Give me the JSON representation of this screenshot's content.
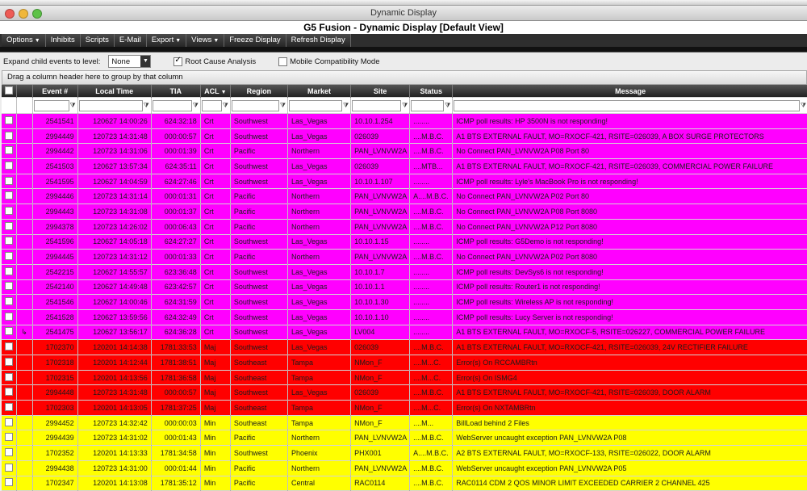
{
  "window": {
    "title": "Dynamic Display",
    "app_title": "G5 Fusion - Dynamic Display [Default View]"
  },
  "colors": {
    "crit": "#ff00ff",
    "maj": "#ff0000",
    "min": "#ffff00"
  },
  "menubar": [
    {
      "label": "Options",
      "caret": true
    },
    {
      "label": "Inhibits",
      "caret": false
    },
    {
      "label": "Scripts",
      "caret": false
    },
    {
      "label": "E-Mail",
      "caret": false
    },
    {
      "label": "Export",
      "caret": true
    },
    {
      "label": "Views",
      "caret": true
    },
    {
      "label": "Freeze Display",
      "caret": false
    },
    {
      "label": "Refresh Display",
      "caret": false
    }
  ],
  "options": {
    "expand_label": "Expand child events to level:",
    "expand_value": "None",
    "root_cause_label": "Root Cause Analysis",
    "root_cause_checked": true,
    "mobile_label": "Mobile Compatibility Mode",
    "mobile_checked": false
  },
  "group_hint": "Drag a column header here to group by that column",
  "columns": [
    "Event #",
    "Local Time",
    "TIA",
    "ACL",
    "Region",
    "Market",
    "Site",
    "Status",
    "Message"
  ],
  "rows": [
    {
      "sev": "crit",
      "event": "2541541",
      "time": "120627 14:00:26",
      "tia": "624:32:18",
      "acl": "Crt",
      "region": "Southwest",
      "market": "Las_Vegas",
      "site": "10.10.1.254",
      "status": "........",
      "msg": "ICMP poll results: HP 3500N is not responding!"
    },
    {
      "sev": "crit",
      "event": "2994449",
      "time": "120723 14:31:48",
      "tia": "000:00:57",
      "acl": "Crt",
      "region": "Southwest",
      "market": "Las_Vegas",
      "site": "026039",
      "status": "....M.B.C.",
      "msg": "A1 BTS EXTERNAL FAULT, MO=RXOCF-421, RSITE=026039, A BOX SURGE PROTECTORS"
    },
    {
      "sev": "crit",
      "event": "2994442",
      "time": "120723 14:31:06",
      "tia": "000:01:39",
      "acl": "Crt",
      "region": "Pacific",
      "market": "Northern",
      "site": "PAN_LVNVW2A",
      "status": "....M.B.C.",
      "msg": "No Connect PAN_LVNVW2A P08 Port 80"
    },
    {
      "sev": "crit",
      "event": "2541503",
      "time": "120627 13:57:34",
      "tia": "624:35:11",
      "acl": "Crt",
      "region": "Southwest",
      "market": "Las_Vegas",
      "site": "026039",
      "status": "....MTB...",
      "msg": "A1 BTS EXTERNAL FAULT, MO=RXOCF-421, RSITE=026039, COMMERCIAL POWER FAILURE"
    },
    {
      "sev": "crit",
      "event": "2541595",
      "time": "120627 14:04:59",
      "tia": "624:27:46",
      "acl": "Crt",
      "region": "Southwest",
      "market": "Las_Vegas",
      "site": "10.10.1.107",
      "status": "........",
      "msg": "ICMP poll results: Lyle's MacBook Pro is not responding!"
    },
    {
      "sev": "crit",
      "event": "2994446",
      "time": "120723 14:31:14",
      "tia": "000:01:31",
      "acl": "Crt",
      "region": "Pacific",
      "market": "Northern",
      "site": "PAN_LVNVW2A",
      "status": "A....M.B.C.",
      "msg": "No Connect PAN_LVNVW2A P02 Port 80"
    },
    {
      "sev": "crit",
      "event": "2994443",
      "time": "120723 14:31:08",
      "tia": "000:01:37",
      "acl": "Crt",
      "region": "Pacific",
      "market": "Northern",
      "site": "PAN_LVNVW2A",
      "status": "....M.B.C.",
      "msg": "No Connect PAN_LVNVW2A P08 Port 8080"
    },
    {
      "sev": "crit",
      "event": "2994378",
      "time": "120723 14:26:02",
      "tia": "000:06:43",
      "acl": "Crt",
      "region": "Pacific",
      "market": "Northern",
      "site": "PAN_LVNVW2A",
      "status": "....M.B.C.",
      "msg": "No Connect PAN_LVNVW2A P12 Port 8080"
    },
    {
      "sev": "crit",
      "event": "2541596",
      "time": "120627 14:05:18",
      "tia": "624:27:27",
      "acl": "Crt",
      "region": "Southwest",
      "market": "Las_Vegas",
      "site": "10.10.1.15",
      "status": "........",
      "msg": "ICMP poll results: G5Demo is not responding!"
    },
    {
      "sev": "crit",
      "event": "2994445",
      "time": "120723 14:31:12",
      "tia": "000:01:33",
      "acl": "Crt",
      "region": "Pacific",
      "market": "Northern",
      "site": "PAN_LVNVW2A",
      "status": "....M.B.C.",
      "msg": "No Connect PAN_LVNVW2A P02 Port 8080"
    },
    {
      "sev": "crit",
      "event": "2542215",
      "time": "120627 14:55:57",
      "tia": "623:36:48",
      "acl": "Crt",
      "region": "Southwest",
      "market": "Las_Vegas",
      "site": "10.10.1.7",
      "status": "........",
      "msg": "ICMP poll results: DevSys6 is not responding!"
    },
    {
      "sev": "crit",
      "event": "2542140",
      "time": "120627 14:49:48",
      "tia": "623:42:57",
      "acl": "Crt",
      "region": "Southwest",
      "market": "Las_Vegas",
      "site": "10.10.1.1",
      "status": "........",
      "msg": "ICMP poll results: Router1 is not responding!"
    },
    {
      "sev": "crit",
      "event": "2541546",
      "time": "120627 14:00:46",
      "tia": "624:31:59",
      "acl": "Crt",
      "region": "Southwest",
      "market": "Las_Vegas",
      "site": "10.10.1.30",
      "status": "........",
      "msg": "ICMP poll results: Wireless AP is not responding!"
    },
    {
      "sev": "crit",
      "event": "2541528",
      "time": "120627 13:59:56",
      "tia": "624:32:49",
      "acl": "Crt",
      "region": "Southwest",
      "market": "Las_Vegas",
      "site": "10.10.1.10",
      "status": "........",
      "msg": "ICMP poll results: Lucy Server is not responding!"
    },
    {
      "sev": "crit",
      "event": "2541475",
      "time": "120627 13:56:17",
      "tia": "624:36:28",
      "acl": "Crt",
      "region": "Southwest",
      "market": "Las_Vegas",
      "site": "LV004",
      "status": "........",
      "msg": "A1 BTS EXTERNAL FAULT, MO=RXOCF-5, RSITE=026227, COMMERCIAL POWER FAILURE",
      "child": true
    },
    {
      "sev": "maj",
      "event": "1702370",
      "time": "120201 14:14:38",
      "tia": "1781:33:53",
      "acl": "Maj",
      "region": "Southwest",
      "market": "Las_Vegas",
      "site": "026039",
      "status": "....M.B.C.",
      "msg": "A1 BTS EXTERNAL FAULT, MO=RXOCF-421, RSITE=026039, 24V RECTIFIER FAILURE"
    },
    {
      "sev": "maj",
      "event": "1702318",
      "time": "120201 14:12:44",
      "tia": "1781:38:51",
      "acl": "Maj",
      "region": "Southeast",
      "market": "Tampa",
      "site": "NMon_F",
      "status": "....M...C.",
      "msg": "Error(s) On RCCAMBRtn"
    },
    {
      "sev": "maj",
      "event": "1702315",
      "time": "120201 14:13:56",
      "tia": "1781:36:58",
      "acl": "Maj",
      "region": "Southeast",
      "market": "Tampa",
      "site": "NMon_F",
      "status": "....M...C.",
      "msg": "Error(s) On ISMG4"
    },
    {
      "sev": "maj",
      "event": "2994448",
      "time": "120723 14:31:48",
      "tia": "000:00:57",
      "acl": "Maj",
      "region": "Southwest",
      "market": "Las_Vegas",
      "site": "026039",
      "status": "....M.B.C.",
      "msg": "A1 BTS EXTERNAL FAULT, MO=RXOCF-421, RSITE=026039, DOOR ALARM"
    },
    {
      "sev": "maj",
      "event": "1702303",
      "time": "120201 14:13:05",
      "tia": "1781:37:25",
      "acl": "Maj",
      "region": "Southeast",
      "market": "Tampa",
      "site": "NMon_F",
      "status": "....M...C.",
      "msg": "Error(s) On NXTAMBRtn"
    },
    {
      "sev": "min",
      "event": "2994452",
      "time": "120723 14:32:42",
      "tia": "000:00:03",
      "acl": "Min",
      "region": "Southeast",
      "market": "Tampa",
      "site": "NMon_F",
      "status": "....M...",
      "msg": "BillLoad behind 2 Files"
    },
    {
      "sev": "min",
      "event": "2994439",
      "time": "120723 14:31:02",
      "tia": "000:01:43",
      "acl": "Min",
      "region": "Pacific",
      "market": "Northern",
      "site": "PAN_LVNVW2A",
      "status": "....M.B.C.",
      "msg": "WebServer uncaught exception PAN_LVNVW2A P08"
    },
    {
      "sev": "min",
      "event": "1702352",
      "time": "120201 14:13:33",
      "tia": "1781:34:58",
      "acl": "Min",
      "region": "Southwest",
      "market": "Phoenix",
      "site": "PHX001",
      "status": "A....M.B.C.",
      "msg": "A2 BTS EXTERNAL FAULT, MO=RXOCF-133, RSITE=026022, DOOR ALARM"
    },
    {
      "sev": "min",
      "event": "2994438",
      "time": "120723 14:31:00",
      "tia": "000:01:44",
      "acl": "Min",
      "region": "Pacific",
      "market": "Northern",
      "site": "PAN_LVNVW2A",
      "status": "....M.B.C.",
      "msg": "WebServer uncaught exception PAN_LVNVW2A P05"
    },
    {
      "sev": "min",
      "event": "1702347",
      "time": "120201 14:13:08",
      "tia": "1781:35:12",
      "acl": "Min",
      "region": "Pacific",
      "market": "Central",
      "site": "RAC0114",
      "status": "....M.B.C.",
      "msg": "RAC0114 CDM 2 QOS MINOR LIMIT EXCEEDED CARRIER 2 CHANNEL 425"
    }
  ]
}
